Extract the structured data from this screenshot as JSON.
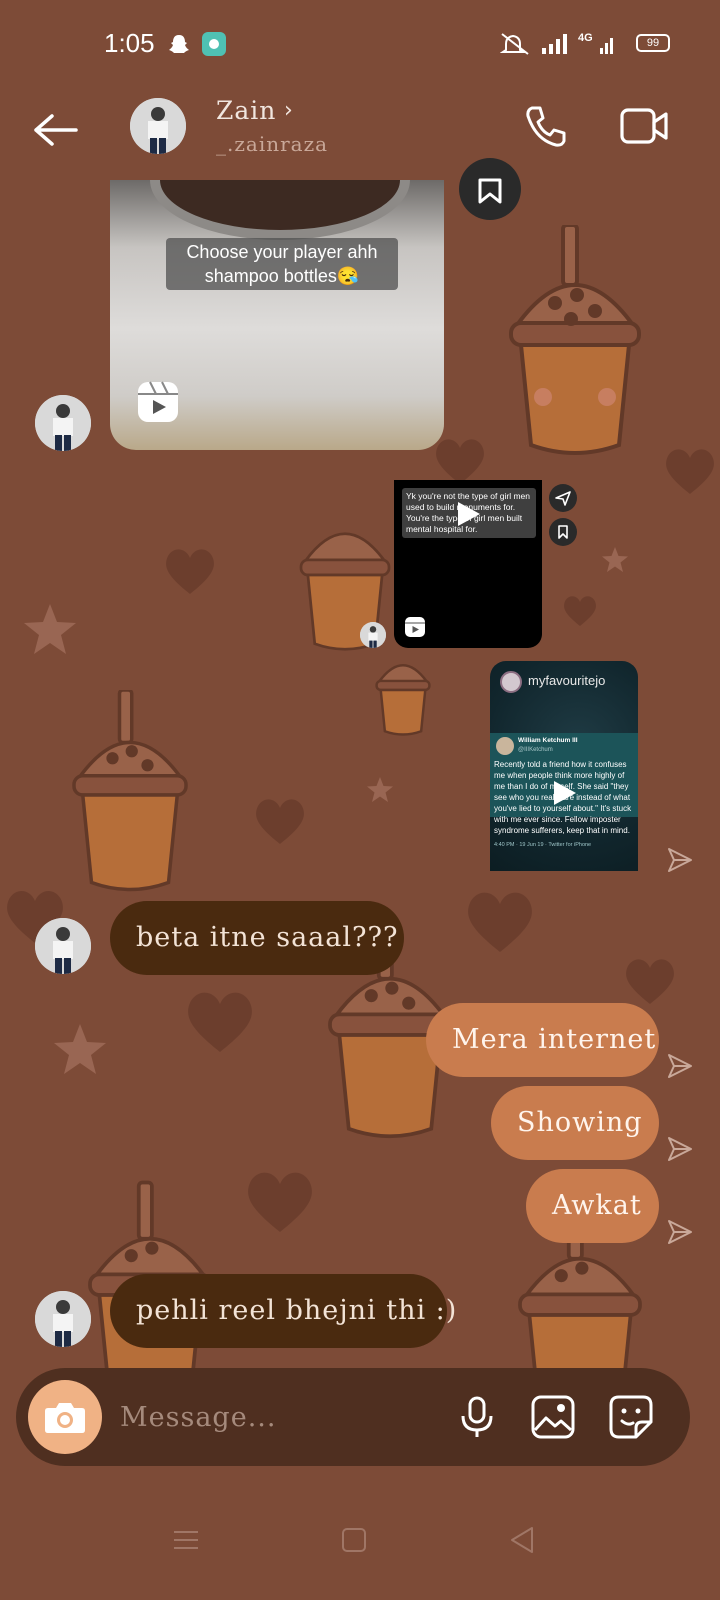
{
  "status_bar": {
    "time": "1:05",
    "battery": "99"
  },
  "header": {
    "name": "Zain",
    "chevron": "›",
    "username": "_.zainraza"
  },
  "messages": {
    "reel1_caption": "Choose your player ahh shampoo bottles😪",
    "reel2_caption": "Yk you're not the type of girl men used to build monuments for. You're the type of girl men built mental hospital for.",
    "reel3": {
      "owner": "myfavouritejo",
      "tweet_name": "William Ketchum III",
      "tweet_handle": "@IIIKetchum",
      "tweet_text": "Recently told a friend how it confuses me when people think more highly of me than I do of myself. She said \"they see who you really are instead of what you've lied to yourself about.\" It's stuck with me ever since. Fellow imposter syndrome sufferers, keep that in mind.",
      "tweet_meta": "4:40 PM · 19 Jun 19 · Twitter for iPhone"
    },
    "incoming_1": "beta itne saaal???",
    "outgoing_1": "Mera internet",
    "outgoing_2": "Showing",
    "outgoing_3": "Awkat",
    "incoming_2": "pehli reel bhejni thi :)"
  },
  "composer": {
    "placeholder": "Message..."
  },
  "colors": {
    "background": "#7d4b37",
    "incoming_bubble": "#4a2a0f",
    "outgoing_bubble": "#c97c4e",
    "camera_button": "#f0b285"
  },
  "icons": [
    "back-arrow-icon",
    "phone-icon",
    "video-camera-icon",
    "reel-icon",
    "bookmark-icon",
    "send-icon",
    "camera-icon",
    "microphone-icon",
    "gallery-icon",
    "sticker-icon"
  ]
}
